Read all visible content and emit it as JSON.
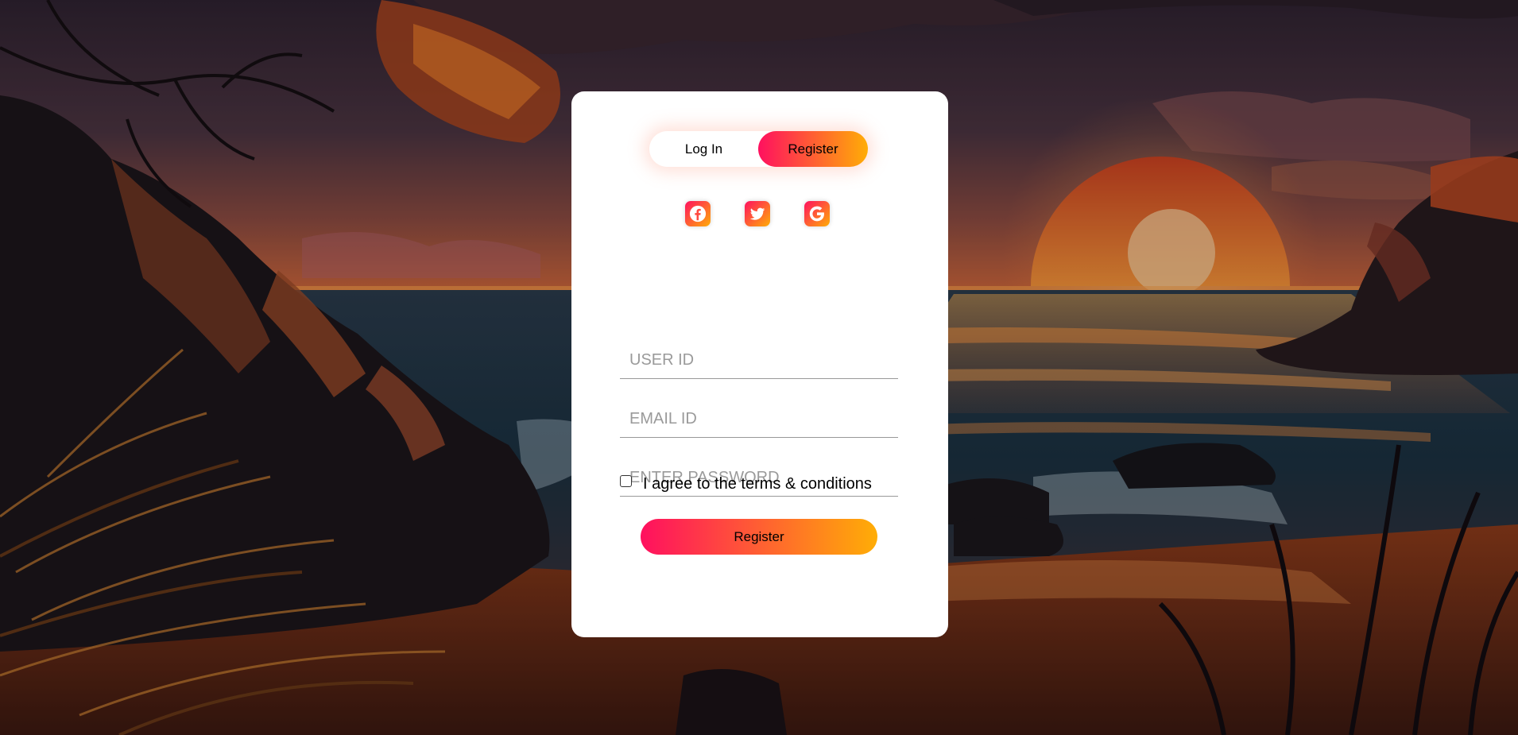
{
  "background": {
    "description_icon": "sunset-beach-illustration",
    "colors": {
      "sky_top": "#3c2a3a",
      "sky_horizon": "#e0703a",
      "sun": "#e85a20",
      "sea": "#1e3848",
      "sand": "#6a3018",
      "rocks": "#1a1418"
    }
  },
  "form": {
    "toggle": {
      "login_label": "Log In",
      "register_label": "Register",
      "active": "register"
    },
    "social": [
      {
        "name": "facebook",
        "icon": "facebook-icon"
      },
      {
        "name": "twitter",
        "icon": "twitter-icon"
      },
      {
        "name": "google",
        "icon": "google-icon"
      }
    ],
    "fields": {
      "user_id_placeholder": "USER ID",
      "user_id_value": "",
      "email_placeholder": "EMAIL ID",
      "email_value": "",
      "password_placeholder": "ENTER PASSWORD",
      "password_value": ""
    },
    "terms": {
      "label": "I agree to the terms & conditions",
      "checked": false
    },
    "submit_label": "Register",
    "accent_gradient": [
      "#ff105f",
      "#ffad06"
    ]
  }
}
